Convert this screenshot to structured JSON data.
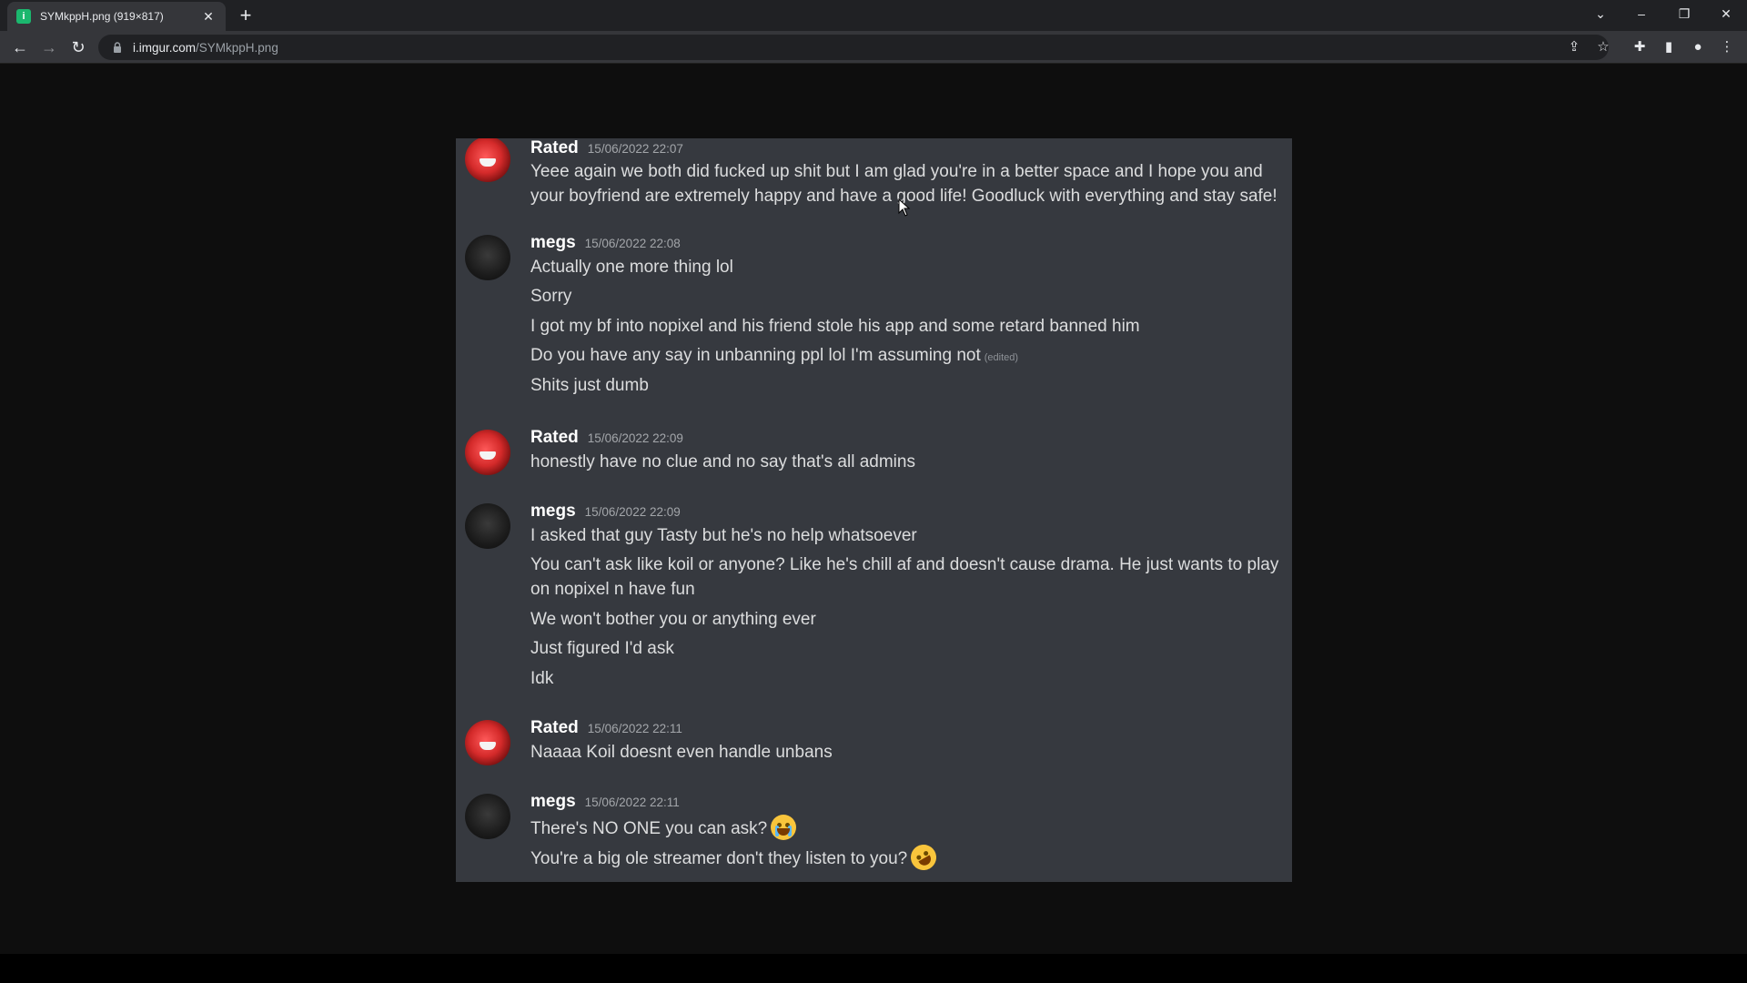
{
  "browser": {
    "tab_title": "SYMkppH.png (919×817)",
    "tab_favicon_letter": "i",
    "url_domain": "i.imgur.com",
    "url_path": "/SYMkppH.png"
  },
  "chat": {
    "groups": [
      {
        "user": "Rated",
        "timestamp": "15/06/2022 22:07",
        "avatar": "rated",
        "lines": [
          "Yeee again we both did fucked up shit but I am glad you're in a better space and I hope you and your boyfriend are extremely happy and have a good life! Goodluck with everything and stay safe!"
        ]
      },
      {
        "user": "megs",
        "timestamp": "15/06/2022 22:08",
        "avatar": "megs",
        "lines": [
          "Actually one more thing lol",
          "Sorry",
          "I got my bf into nopixel and his friend stole his app and some retard banned him",
          "Do you have any say in unbanning ppl lol I'm assuming not",
          "Shits just dumb"
        ],
        "edited_label": "(edited)"
      },
      {
        "user": "Rated",
        "timestamp": "15/06/2022 22:09",
        "avatar": "rated",
        "lines": [
          "honestly have no clue and no say that's all admins"
        ]
      },
      {
        "user": "megs",
        "timestamp": "15/06/2022 22:09",
        "avatar": "megs",
        "lines": [
          "I asked that guy Tasty but he's no help whatsoever",
          "You can't ask like koil or anyone? Like he's chill af and doesn't cause drama. He just wants to play on nopixel n have fun",
          "We won't bother you or anything ever",
          "Just figured I'd ask",
          "Idk"
        ]
      },
      {
        "user": "Rated",
        "timestamp": "15/06/2022 22:11",
        "avatar": "rated",
        "lines": [
          "Naaaa Koil doesnt even handle unbans"
        ]
      },
      {
        "user": "megs",
        "timestamp": "15/06/2022 22:11",
        "avatar": "megs",
        "lines": [
          "There's NO ONE you can ask?",
          "You're a big ole streamer don't they listen to you?"
        ],
        "emojis": [
          "loudly-crying-emoji",
          "rolling-on-floor-laughing-emoji"
        ]
      }
    ]
  }
}
